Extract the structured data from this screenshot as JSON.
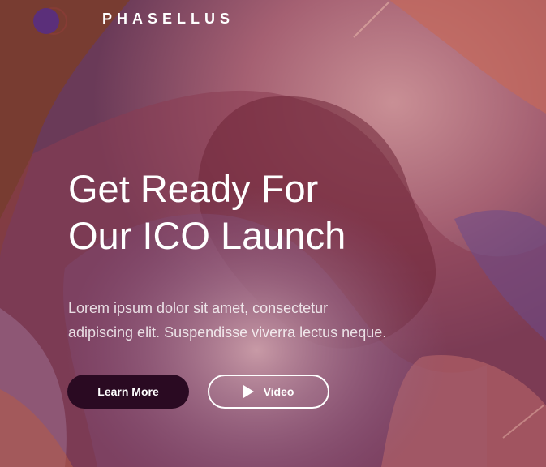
{
  "brand": {
    "name": "PHASELLUS",
    "logo": "logo-mark-icon"
  },
  "hero": {
    "title_line1": "Get Ready For",
    "title_line2": "Our ICO Launch",
    "subtitle_line1": "Lorem ipsum dolor sit amet, consectetur",
    "subtitle_line2": "adipiscing elit. Suspendisse viverra lectus neque."
  },
  "buttons": {
    "learn_more": "Learn More",
    "video": "Video",
    "video_icon": "play-icon"
  },
  "colors": {
    "learn_more_bg": "#2a0a22",
    "logo_purple": "#5b2f7a",
    "text": "#ffffff"
  }
}
